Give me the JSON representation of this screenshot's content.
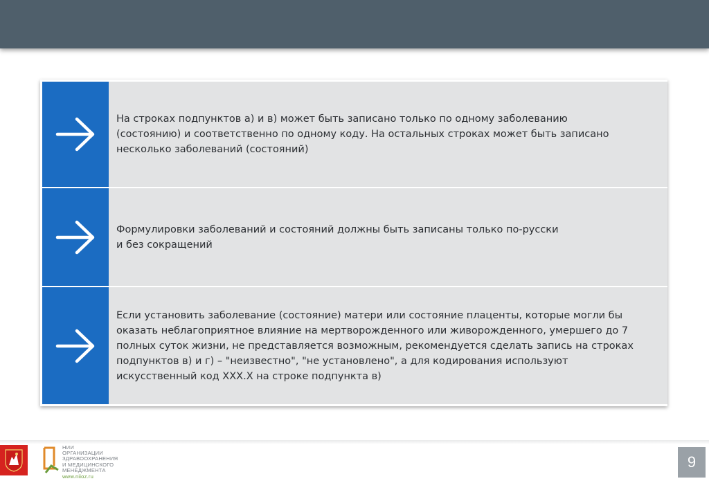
{
  "items": [
    {
      "icon": "right-arrow-icon",
      "text": "На строках подпунктов а) и в) может быть записано только по одному заболеванию\n(состоянию) и соответственно по одному коду. На остальных строках может быть записано\nнесколько заболеваний (состояний)"
    },
    {
      "icon": "right-arrow-icon",
      "text": "Формулировки заболеваний и состояний должны быть записаны только по-русски\nи без сокращений"
    },
    {
      "icon": "right-arrow-icon",
      "text": "Если установить заболевание (состояние) матери или состояние плаценты, которые могли бы\nоказать неблагоприятное влияние на мертворожденного или живорожденного, умершего до 7\nполных суток жизни, не представляется возможным, рекомендуется сделать запись на строках\nподпунктов в) и г) – \"неизвестно\", \"не установлено\", а для кодирования используют\nискусственный код XXX.X на строке подпункта в)"
    }
  ],
  "footer": {
    "org_lines": [
      "НИИ",
      "ОРГАНИЗАЦИИ",
      "ЗДРАВООХРАНЕНИЯ",
      "И МЕДИЦИНСКОГО",
      "МЕНЕДЖМЕНТА"
    ],
    "org_url": "www.niioz.ru",
    "page_number": "9"
  },
  "colors": {
    "topbar": "#4f5f6b",
    "accent": "#1b6cc2",
    "row_bg": "#e2e3e4",
    "crest": "#d6231f",
    "page_badge": "#9aa1a7"
  }
}
